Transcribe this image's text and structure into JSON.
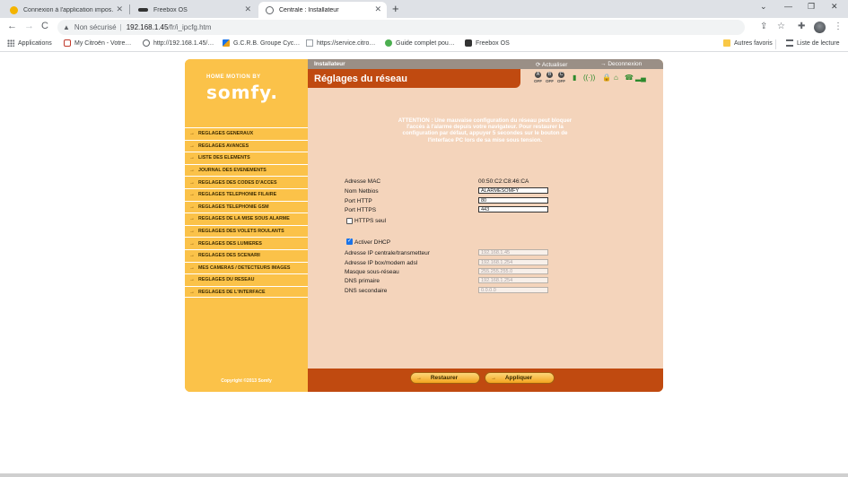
{
  "browser": {
    "tabs": [
      {
        "title": "Connexion à l'application impos…",
        "icon": "warning-icon"
      },
      {
        "title": "Freebox OS",
        "icon": "freebox-icon"
      },
      {
        "title": "Centrale : Installateur",
        "icon": "globe-icon",
        "active": true
      }
    ],
    "new_tab": "+",
    "window_controls": {
      "collapse": "⌄",
      "minimize": "—",
      "restore": "❐",
      "close": "✕"
    },
    "nav": {
      "back": "←",
      "forward": "→",
      "reload": "C"
    },
    "address": {
      "security_label": "Non sécurisé",
      "separator": "|",
      "host": "192.168.1.45",
      "path": "/fr/i_ipcfg.htm"
    },
    "bookmarks": [
      {
        "label": "Applications",
        "icon": "apps-icon"
      },
      {
        "label": "My Citroën - Votre…",
        "icon": "citroen-icon"
      },
      {
        "label": "http://192.168.1.45/…",
        "icon": "globe-icon"
      },
      {
        "label": "G.C.R.B. Groupe Cyc…",
        "icon": "gcrb-icon"
      },
      {
        "label": "https://service.citro…",
        "icon": "page-icon"
      },
      {
        "label": "Guide complet pou…",
        "icon": "guide-icon"
      },
      {
        "label": "Freebox OS",
        "icon": "freebox-icon"
      }
    ],
    "bookmarks_right": [
      {
        "label": "Autres favoris",
        "icon": "folder-icon"
      },
      {
        "label": "Liste de lecture",
        "icon": "reading-list-icon"
      }
    ]
  },
  "somfy": {
    "logo_tagline": "HOME MOTION BY",
    "logo": "somfy.",
    "menu": [
      "REGLAGES GENERAUX",
      "REGLAGES AVANCES",
      "LISTE DES ELEMENTS",
      "JOURNAL DES EVENEMENTS",
      "REGLAGES DES CODES D'ACCES",
      "REGLAGES TELEPHONIE FILAIRE",
      "REGLAGES TELEPHONIE GSM",
      "REGLAGES DE LA MISE SOUS ALARME",
      "REGLAGES DES VOLETS ROULANTS",
      "REGLAGES DES LUMIERES",
      "REGLAGES DES SCENARII",
      "MES CAMERAS / DETECTEURS IMAGES",
      "REGLAGES DU RESEAU",
      "REGLAGES DE L'INTERFACE"
    ],
    "copyright": "Copyright ©2013 Somfy",
    "section": "Installateur",
    "refresh": "Actualiser",
    "logout": "Deconnexion",
    "page_title": "Réglages du réseau",
    "zones": [
      {
        "letter": "A",
        "state": "OFF"
      },
      {
        "letter": "B",
        "state": "OFF"
      },
      {
        "letter": "C",
        "state": "OFF"
      }
    ],
    "attention": "ATTENTION : Une mauvaise configuration du réseau peut bloquer l'accès à l'alarme depuis votre navigateur. Pour restaurer la configuration par défaut, appuyer 5 secondes sur le bouton de l'interface PC lors de sa mise sous tension.",
    "form": {
      "mac_label": "Adresse MAC",
      "mac_value": "00:50:C2:C8:46:CA",
      "netbios_label": "Nom Netbios",
      "netbios_value": "ALARMESOMFY",
      "http_label": "Port HTTP",
      "http_value": "80",
      "https_label": "Port HTTPS",
      "https_value": "443",
      "https_only_label": "HTTPS seul",
      "dhcp_label": "Activer DHCP",
      "ip_central_label": "Adresse IP centrale/transmetteur",
      "ip_central_value": "192.168.1.45",
      "ip_box_label": "Adresse IP box/modem adsl",
      "ip_box_value": "192.168.1.254",
      "mask_label": "Masque sous-réseau",
      "mask_value": "255.255.255.0",
      "dns1_label": "DNS primaire",
      "dns1_value": "192.168.1.254",
      "dns2_label": "DNS secondaire",
      "dns2_value": "0.0.0.0"
    },
    "restore_label": "Restaurer",
    "apply_label": "Appliquer"
  }
}
